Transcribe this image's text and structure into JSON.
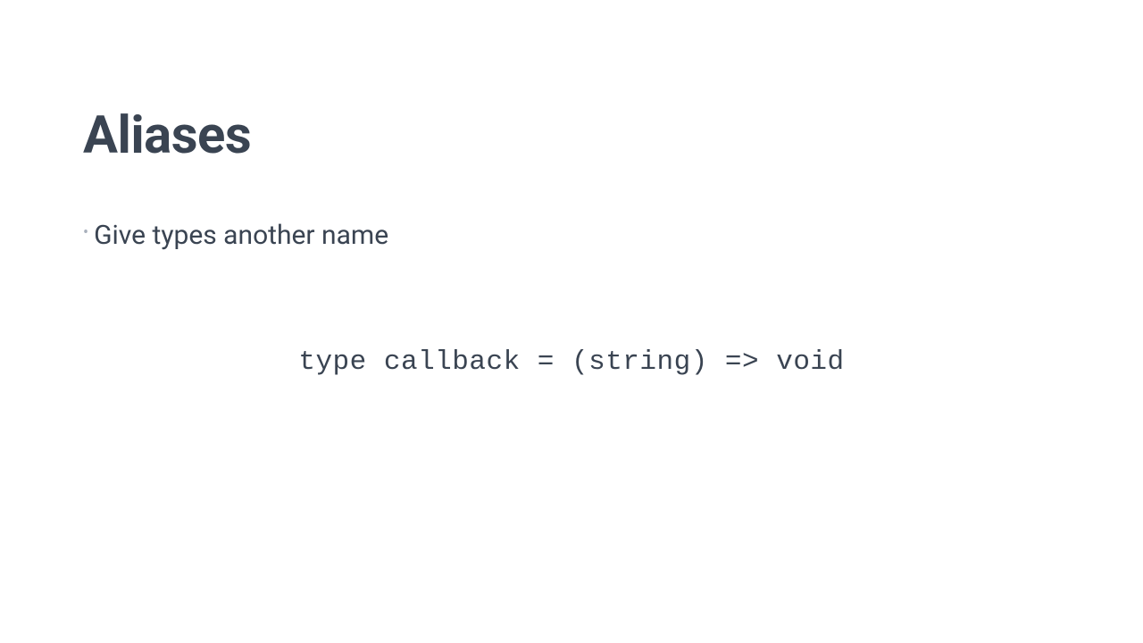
{
  "slide": {
    "title": "Aliases",
    "bullets": [
      "Give types another name"
    ],
    "code": "type callback = (string) => void"
  }
}
